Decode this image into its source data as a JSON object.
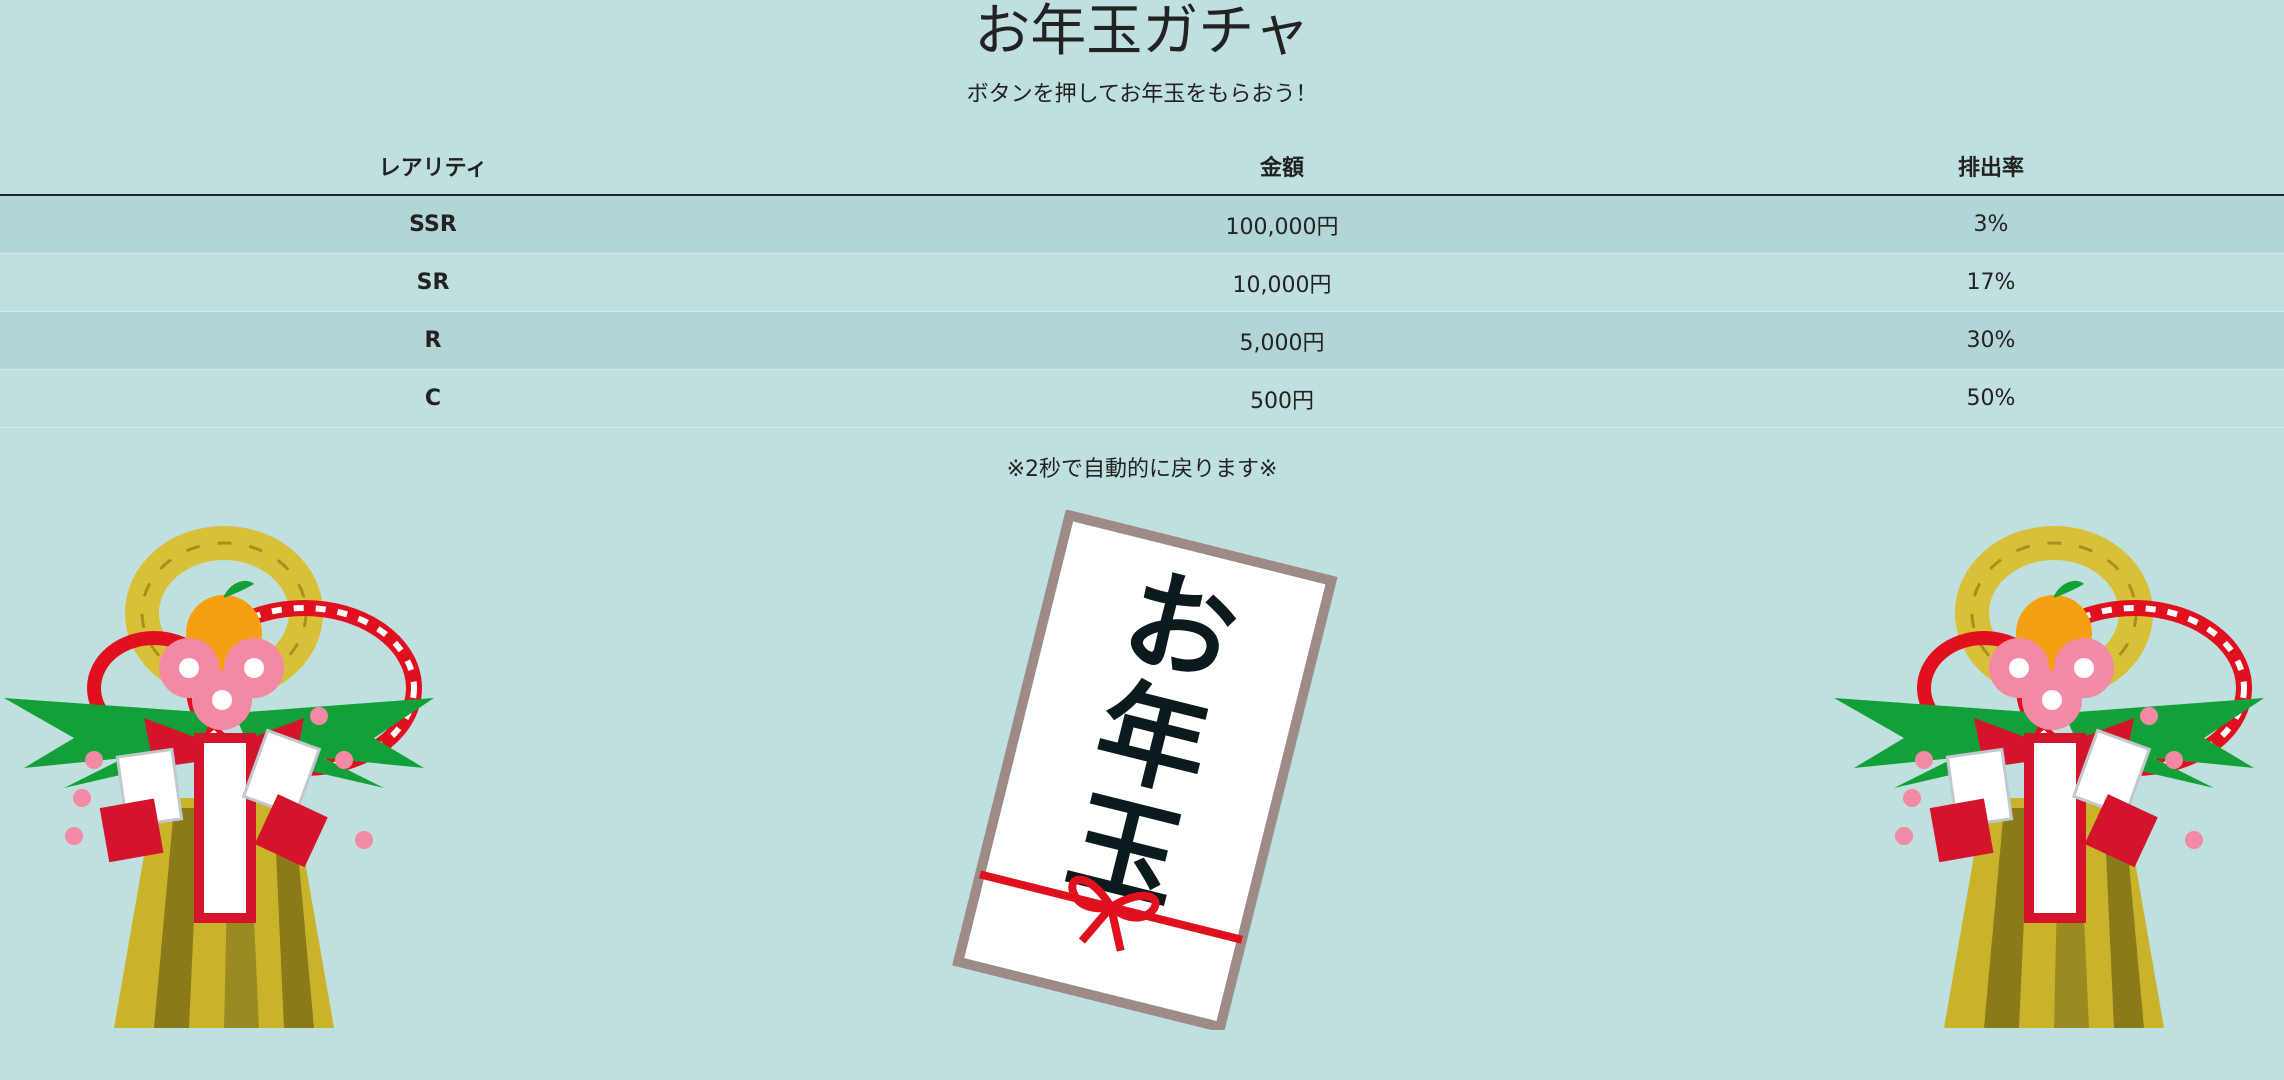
{
  "header": {
    "title": "お年玉ガチャ",
    "subtitle": "ボタンを押してお年玉をもらおう！"
  },
  "table": {
    "headers": [
      "レアリティ",
      "金額",
      "排出率"
    ],
    "rows": [
      {
        "rarity": "SSR",
        "amount": "100,000円",
        "rate": "3%"
      },
      {
        "rarity": "SR",
        "amount": "10,000円",
        "rate": "17%"
      },
      {
        "rarity": "R",
        "amount": "5,000円",
        "rate": "30%"
      },
      {
        "rarity": "C",
        "amount": "500円",
        "rate": "50%"
      }
    ]
  },
  "note": "※2秒で自動的に戻ります※",
  "images": {
    "left_decoration": "kadomatsu-shimekazari-icon",
    "center_envelope": "otoshidama-envelope-icon",
    "envelope_text": "お年玉",
    "right_decoration": "kadomatsu-shimekazari-icon"
  },
  "colors": {
    "background": "#c0e0df",
    "row_stripe": "#b2d6d5",
    "ribbon_red": "#e0101e"
  }
}
